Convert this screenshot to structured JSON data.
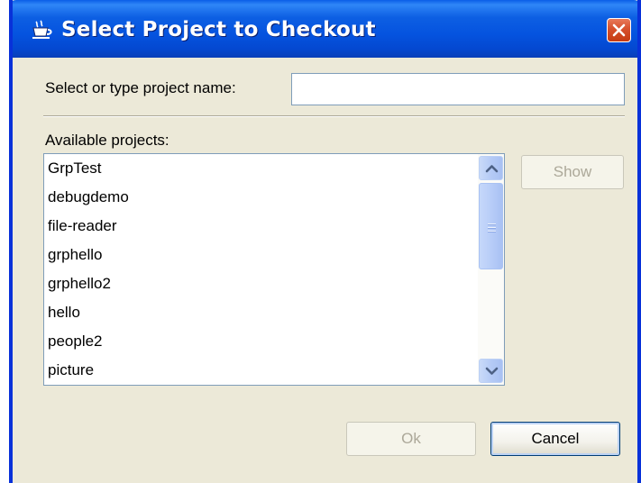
{
  "window": {
    "title": "Select Project to Checkout",
    "title_icon": "coffee-cup-icon",
    "close_icon": "close-icon"
  },
  "form": {
    "name_label": "Select or type project name:",
    "name_value": "",
    "available_label": "Available projects:"
  },
  "projects": [
    "GrpTest",
    "debugdemo",
    "file-reader",
    "grphello",
    "grphello2",
    "hello",
    "people2",
    "picture"
  ],
  "buttons": {
    "show": "Show",
    "ok": "Ok",
    "cancel": "Cancel"
  },
  "colors": {
    "titlebar": "#0553df",
    "dialog_bg": "#ece9d8",
    "disabled_text": "#aca899",
    "close_button": "#d6502c"
  }
}
